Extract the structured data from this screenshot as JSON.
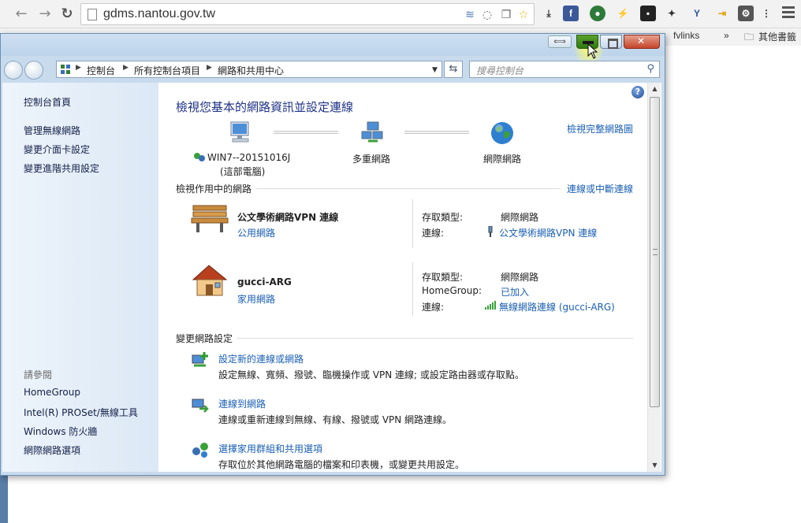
{
  "browser": {
    "url": "gdms.nantou.gov.tw",
    "bookmarks": {
      "fvlinks": "fvlinks",
      "more": "»",
      "other_bookmarks": "其他書籤"
    }
  },
  "window": {
    "address": {
      "crumbs": [
        "控制台",
        "所有控制台項目",
        "網路和共用中心"
      ],
      "search_placeholder": "搜尋控制台"
    }
  },
  "left_pane": {
    "links": [
      "控制台首頁",
      "管理無線網路",
      "變更介面卡設定",
      "變更進階共用設定"
    ],
    "see_also_heading": "請參閱",
    "see_also": [
      "HomeGroup",
      "Intel(R) PROSet/無線工具",
      "Windows 防火牆",
      "網際網路選項"
    ]
  },
  "content": {
    "title": "檢視您基本的網路資訊並設定連線",
    "view_full_map": "檢視完整網路圖",
    "map": {
      "computer_name": "WIN7--20151016J",
      "computer_sub": "(這部電腦)",
      "middle": "多重網路",
      "internet": "網際網路"
    },
    "active_networks_heading": "檢視作用中的網路",
    "connect_disconnect": "連線或中斷連線",
    "networks": [
      {
        "name": "公文學術網路VPN 連線",
        "type": "公用網路",
        "access_label": "存取類型:",
        "access_value": "網際網路",
        "connection_label": "連線:",
        "connection_value": "公文學術網路VPN 連線"
      },
      {
        "name": "gucci-ARG",
        "type": "家用網路",
        "access_label": "存取類型:",
        "access_value": "網際網路",
        "homegroup_label": "HomeGroup:",
        "homegroup_value": "已加入",
        "connection_label": "連線:",
        "connection_value": "無線網路連線 (gucci-ARG)"
      }
    ],
    "change_settings_heading": "變更網路設定",
    "tasks": [
      {
        "title": "設定新的連線或網路",
        "desc": "設定無線、寬頻、撥號、臨機操作或 VPN 連線; 或設定路由器或存取點。"
      },
      {
        "title": "連線到網路",
        "desc": "連線或重新連線到無線、有線、撥號或 VPN 網路連線。"
      },
      {
        "title": "選擇家用群組和共用選項",
        "desc": "存取位於其他網路電腦的檔案和印表機，或變更共用設定。"
      }
    ]
  },
  "colors": {
    "link": "#1a5fb4",
    "title": "#1e3287",
    "left_pane": "#dbe8f5"
  }
}
